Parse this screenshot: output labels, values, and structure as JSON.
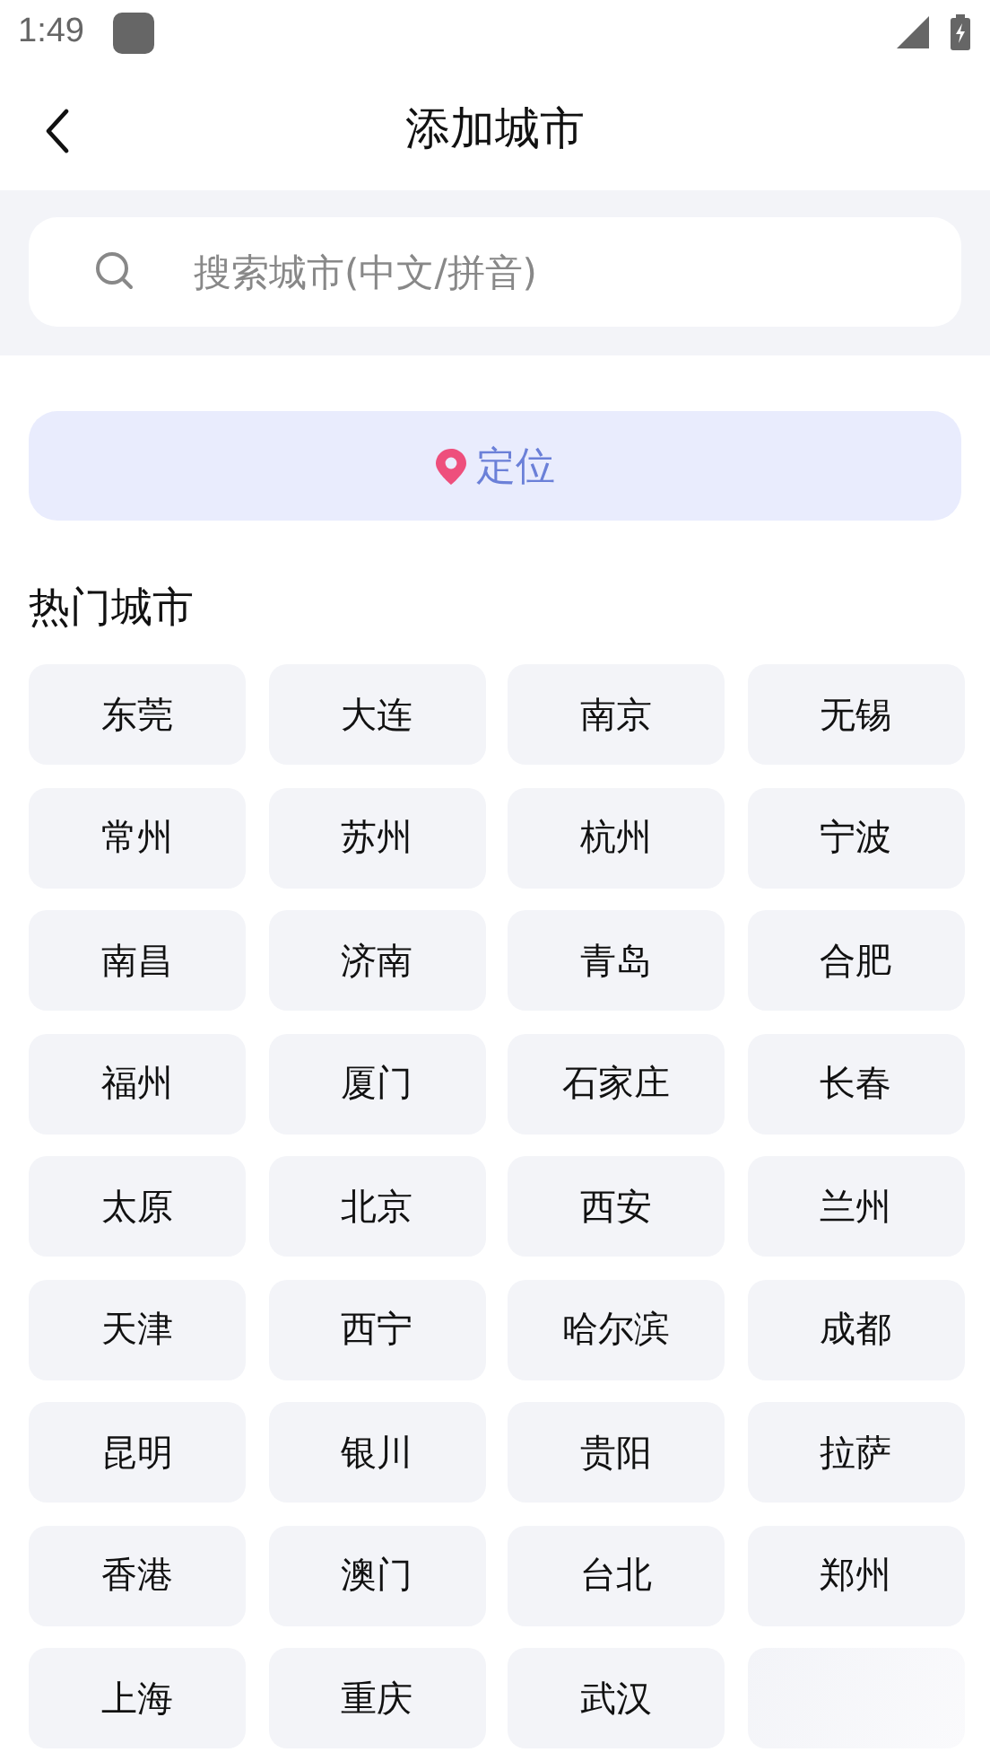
{
  "status_bar": {
    "time": "1:49"
  },
  "header": {
    "title": "添加城市"
  },
  "search": {
    "placeholder": "搜索城市(中文/拼音)"
  },
  "locate_button": {
    "label": "定位"
  },
  "hot_cities": {
    "title": "热门城市",
    "cities": [
      {
        "kind": "city",
        "name": "东莞"
      },
      {
        "kind": "city",
        "name": "大连"
      },
      {
        "kind": "city",
        "name": "南京"
      },
      {
        "kind": "city",
        "name": "无锡"
      },
      {
        "kind": "city",
        "name": "常州"
      },
      {
        "kind": "city",
        "name": "苏州"
      },
      {
        "kind": "city",
        "name": "杭州"
      },
      {
        "kind": "city",
        "name": "宁波"
      },
      {
        "kind": "city",
        "name": "南昌"
      },
      {
        "kind": "city",
        "name": "济南"
      },
      {
        "kind": "city",
        "name": "青岛"
      },
      {
        "kind": "city",
        "name": "合肥"
      },
      {
        "kind": "city",
        "name": "福州"
      },
      {
        "kind": "city",
        "name": "厦门"
      },
      {
        "kind": "city",
        "name": "石家庄"
      },
      {
        "kind": "city",
        "name": "长春"
      },
      {
        "kind": "city",
        "name": "太原"
      },
      {
        "kind": "city",
        "name": "北京"
      },
      {
        "kind": "city",
        "name": "西安"
      },
      {
        "kind": "city",
        "name": "兰州"
      },
      {
        "kind": "city",
        "name": "天津"
      },
      {
        "kind": "city",
        "name": "西宁"
      },
      {
        "kind": "city",
        "name": "哈尔滨"
      },
      {
        "kind": "city",
        "name": "成都"
      },
      {
        "kind": "city",
        "name": "昆明"
      },
      {
        "kind": "city",
        "name": "银川"
      },
      {
        "kind": "city",
        "name": "贵阳"
      },
      {
        "kind": "city",
        "name": "拉萨"
      },
      {
        "kind": "city",
        "name": "香港"
      },
      {
        "kind": "city",
        "name": "澳门"
      },
      {
        "kind": "city",
        "name": "台北"
      },
      {
        "kind": "city",
        "name": "郑州"
      },
      {
        "kind": "city",
        "name": "上海"
      },
      {
        "kind": "city",
        "name": "重庆"
      },
      {
        "kind": "city",
        "name": "武汉"
      },
      {
        "kind": "blank"
      }
    ]
  }
}
